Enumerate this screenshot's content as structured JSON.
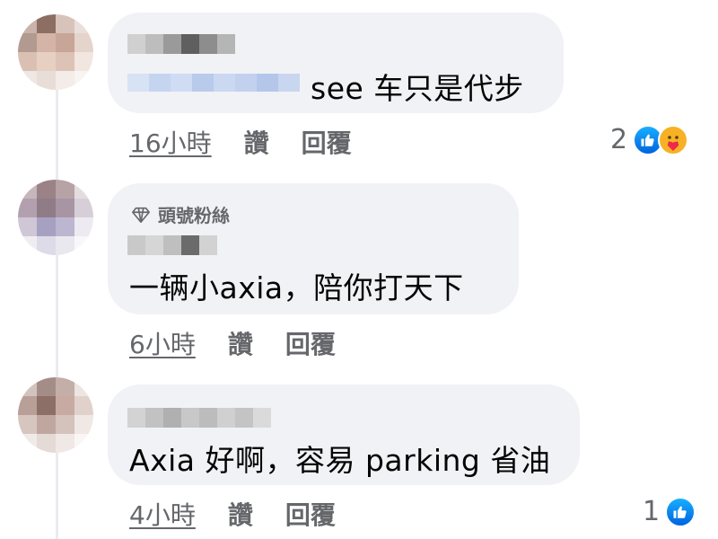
{
  "comments": [
    {
      "text_suffix": "see 车只是代步",
      "time": "16小時",
      "like_label": "讚",
      "reply_label": "回覆",
      "reaction_count": "2",
      "reactions": [
        "like",
        "care"
      ]
    },
    {
      "badge": "頭號粉絲",
      "text": "一辆小axia，陪你打天下",
      "time": "6小時",
      "like_label": "讚",
      "reply_label": "回覆"
    },
    {
      "text": "Axia 好啊，容易 parking 省油",
      "time": "4小時",
      "like_label": "讚",
      "reply_label": "回覆",
      "reaction_count": "1",
      "reactions": [
        "like"
      ]
    }
  ],
  "colors": {
    "bubble": "#f0f2f5",
    "meta_text": "#65676b",
    "like_blue": "#1877f2",
    "link_blur": "#c8d7f2"
  },
  "icons": [
    "diamond-icon",
    "like-reaction-icon",
    "care-reaction-icon"
  ]
}
